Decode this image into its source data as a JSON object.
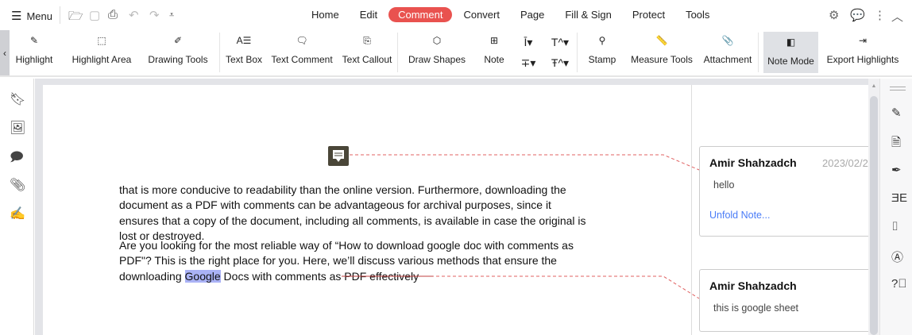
{
  "topbar": {
    "menu_label": "Menu",
    "tabs": [
      "Home",
      "Edit",
      "Comment",
      "Convert",
      "Page",
      "Fill & Sign",
      "Protect",
      "Tools"
    ],
    "active_tab": "Comment"
  },
  "toolbar": {
    "items": [
      "Highlight",
      "Highlight Area",
      "Drawing Tools",
      "Text Box",
      "Text Comment",
      "Text Callout",
      "Draw Shapes",
      "Note",
      "Stamp",
      "Measure Tools",
      "Attachment",
      "Note Mode",
      "Export Highlights"
    ],
    "active": "Note Mode"
  },
  "document": {
    "paragraph1": [
      "that is more conducive to readability than the online version. Furthermore, downloading the",
      "document as a PDF with comments can be advantageous for archival purposes, since it",
      "ensures that a copy of the document, including all comments, is available in case the original is",
      "lost or destroyed."
    ],
    "paragraph2": [
      "Are you looking for the most reliable way of “How to download google doc with comments as",
      "PDF\"? This is the right place for you. Here, we’ll discuss various methods that ensure the"
    ],
    "p2_line3_pre": "downloading ",
    "p2_line3_highlight": "Google",
    "p2_line3_strike": " Docs with comments as PDF effectively"
  },
  "notes": [
    {
      "author": "Amir Shahzadch",
      "date": "2023/02/2",
      "text": "hello",
      "unfold": "Unfold Note..."
    },
    {
      "author": "Amir Shahzadch",
      "text": "this is google sheet"
    }
  ],
  "colors": {
    "accent": "#e9524f",
    "highlight": "#aab2f5",
    "link": "#4a7cf7",
    "annotation_line": "#e06060"
  }
}
